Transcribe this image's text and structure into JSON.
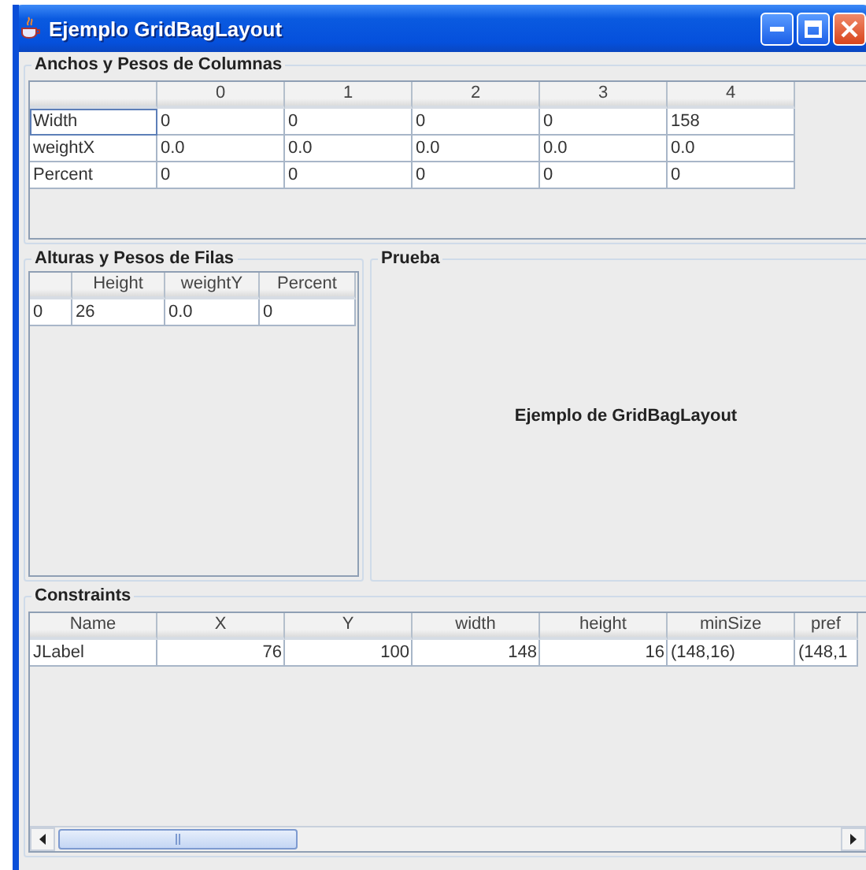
{
  "window": {
    "title": "Ejemplo GridBagLayout"
  },
  "columns_panel": {
    "title": "Anchos y Pesos de Columnas",
    "table": {
      "columns": [
        "0",
        "1",
        "2",
        "3",
        "4"
      ],
      "rows": [
        {
          "label": "Width",
          "focused": true,
          "cells": [
            "0",
            "0",
            "0",
            "0",
            "158"
          ]
        },
        {
          "label": "weightX",
          "focused": false,
          "cells": [
            "0.0",
            "0.0",
            "0.0",
            "0.0",
            "0.0"
          ]
        },
        {
          "label": "Percent",
          "focused": false,
          "cells": [
            "0",
            "0",
            "0",
            "0",
            "0"
          ]
        }
      ]
    }
  },
  "rows_panel": {
    "title": "Alturas y Pesos de Filas",
    "table": {
      "columns": [
        "Height",
        "weightY",
        "Percent"
      ],
      "rows": [
        {
          "label": "0",
          "focused": false,
          "cells": [
            "26",
            "0.0",
            "0"
          ]
        }
      ]
    }
  },
  "test_panel": {
    "title": "Prueba",
    "label": "Ejemplo de GridBagLayout"
  },
  "constraints_panel": {
    "title": "Constraints",
    "table": {
      "columns": [
        {
          "label": "Name",
          "kind": "text"
        },
        {
          "label": "X",
          "kind": "number"
        },
        {
          "label": "Y",
          "kind": "number"
        },
        {
          "label": "width",
          "kind": "number"
        },
        {
          "label": "height",
          "kind": "number"
        },
        {
          "label": "minSize",
          "kind": "text"
        },
        {
          "label": "pref",
          "kind": "text"
        }
      ],
      "rows": [
        {
          "cells": [
            "JLabel",
            "76",
            "100",
            "148",
            "16",
            "(148,16)",
            "(148,1"
          ]
        }
      ]
    }
  }
}
